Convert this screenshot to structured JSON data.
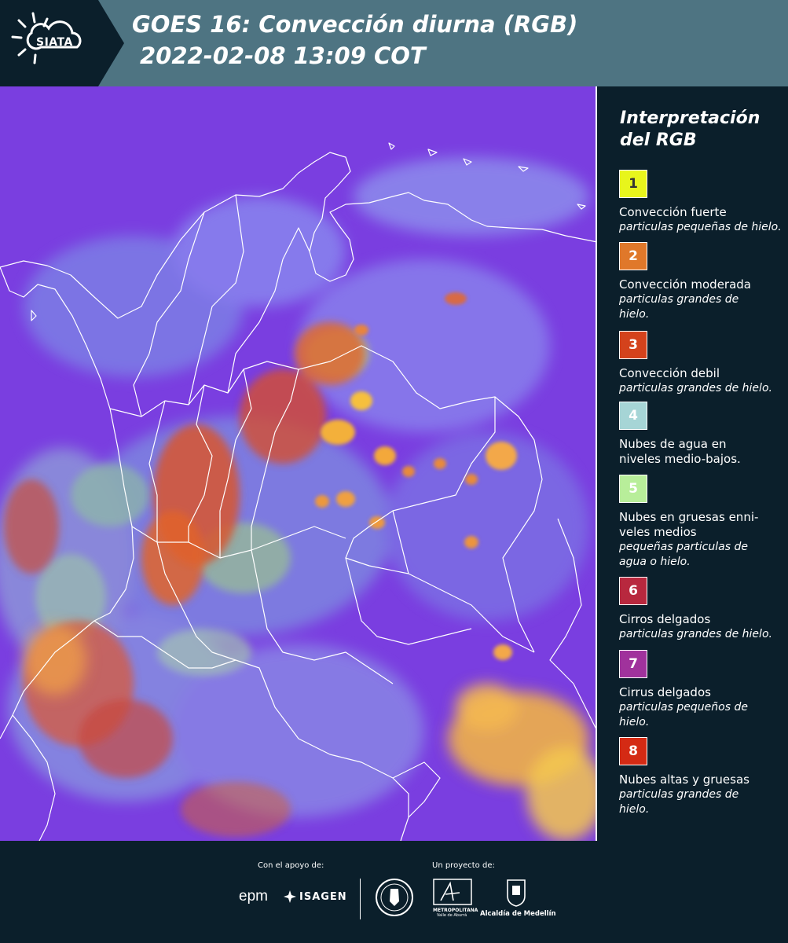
{
  "header": {
    "logo_text": "SIATA",
    "title_line1": "GOES 16: Convección diurna (RGB)",
    "title_line2": "2022-02-08 13:09 COT"
  },
  "colors": {
    "header_bg": "#4e7482",
    "logo_bg": "#0b1f2b",
    "panel_bg": "#0b1f2b",
    "map_base": "#7a3ee0"
  },
  "legend": {
    "title": "Interpretación del RGB",
    "items": [
      {
        "number": "1",
        "color": "#e8f51c",
        "text_color": "#333333",
        "label": "Convección fuerte",
        "sub": "particulas pequeñas de hielo."
      },
      {
        "number": "2",
        "color": "#e0782a",
        "text_color": "#ffffff",
        "label": "Convección moderada",
        "sub": "particulas grandes de hielo."
      },
      {
        "number": "3",
        "color": "#d4421c",
        "text_color": "#ffffff",
        "label": "Convección debil",
        "sub": "particulas grandes de hielo."
      },
      {
        "number": "4",
        "color": "#a6d5d6",
        "text_color": "#ffffff",
        "label": "Nubes de agua en niveles medio-bajos.",
        "sub": ""
      },
      {
        "number": "5",
        "color": "#b8ee9a",
        "text_color": "#ffffff",
        "label": "Nubes en gruesas enni-veles medios",
        "sub": "pequeñas particulas de agua o hielo."
      },
      {
        "number": "6",
        "color": "#b8283e",
        "text_color": "#ffffff",
        "label": "Cirros delgados",
        "sub": "particulas grandes de hielo."
      },
      {
        "number": "7",
        "color": "#a0329c",
        "text_color": "#ffffff",
        "label": "Cirrus delgados",
        "sub": "particulas pequeños de hielo."
      },
      {
        "number": "8",
        "color": "#d42a14",
        "text_color": "#ffffff",
        "label": "Nubes altas y gruesas",
        "sub": "particulas grandes de hielo."
      }
    ]
  },
  "footer": {
    "support_caption": "Con el apoyo de:",
    "project_caption": "Un proyecto de:",
    "support_logos": [
      "epm",
      "ISAGEN"
    ],
    "project_logos": [
      "METROPOLITANA",
      "Valle de Aburrá",
      "Alcaldía de Medellín"
    ]
  }
}
